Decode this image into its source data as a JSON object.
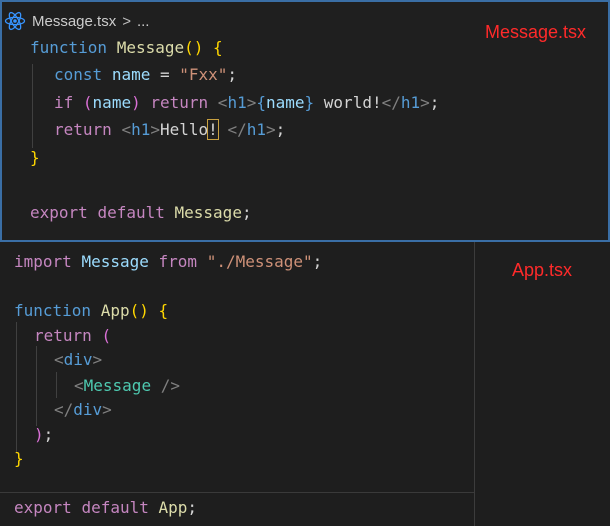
{
  "top": {
    "breadcrumb_file": "Message.tsx",
    "breadcrumb_sep": ">",
    "breadcrumb_more": "...",
    "file_label": "Message.tsx",
    "lines": {
      "l1": {
        "kw": "function",
        "name": "Message",
        "parens": "()",
        "brace": "{"
      },
      "l2": {
        "kw": "const",
        "var": "name",
        "eq": " = ",
        "str": "\"Fxx\"",
        "semi": ";"
      },
      "l3": {
        "kw": "if",
        "p_open": "(",
        "var": "name",
        "p_close": ")",
        "ret": "return",
        "lt1": "<",
        "tag1": "h1",
        "gt1": ">",
        "b_open": "{",
        "expr": "name",
        "b_close": "}",
        "text": " world!",
        "lt2": "</",
        "tag2": "h1",
        "gt2": ">",
        "semi": ";"
      },
      "l4": {
        "ret": "return",
        "lt1": "<",
        "tag1": "h1",
        "gt1": ">",
        "text_a": "Hello",
        "text_b": "!",
        "text_c": " ",
        "lt2": "</",
        "tag2": "h1",
        "gt2": ">",
        "semi": ";"
      },
      "l5": {
        "brace": "}"
      },
      "l7": {
        "export": "export",
        "default": "default",
        "name": "Message",
        "semi": ";"
      }
    }
  },
  "bottom": {
    "file_label": "App.tsx",
    "lines": {
      "l1": {
        "import": "import",
        "name": "Message",
        "from": "from",
        "path": "\"./Message\"",
        "semi": ";"
      },
      "l3": {
        "kw": "function",
        "name": "App",
        "parens": "()",
        "brace": "{"
      },
      "l4": {
        "ret": "return",
        "paren": "("
      },
      "l5": {
        "lt": "<",
        "tag": "div",
        "gt": ">"
      },
      "l6": {
        "lt": "<",
        "comp": "Message",
        "close": " />"
      },
      "l7": {
        "lt": "</",
        "tag": "div",
        "gt": ">"
      },
      "l8": {
        "paren": ")",
        "semi": ";"
      },
      "l9": {
        "brace": "}"
      },
      "l11": {
        "export": "export",
        "default": "default",
        "name": "App",
        "semi": ";"
      }
    }
  },
  "icons": {
    "react": "react-icon"
  },
  "colors": {
    "background": "#1e1e1e",
    "panel_border": "#3a6ea5",
    "label_red": "#ff2a2a",
    "keyword_blue": "#569cd6",
    "keyword_purple": "#c586c0",
    "function_yellow": "#dcdcaa",
    "variable_cyan": "#9cdcfe",
    "string_orange": "#ce9178",
    "component_teal": "#4ec9b0"
  }
}
